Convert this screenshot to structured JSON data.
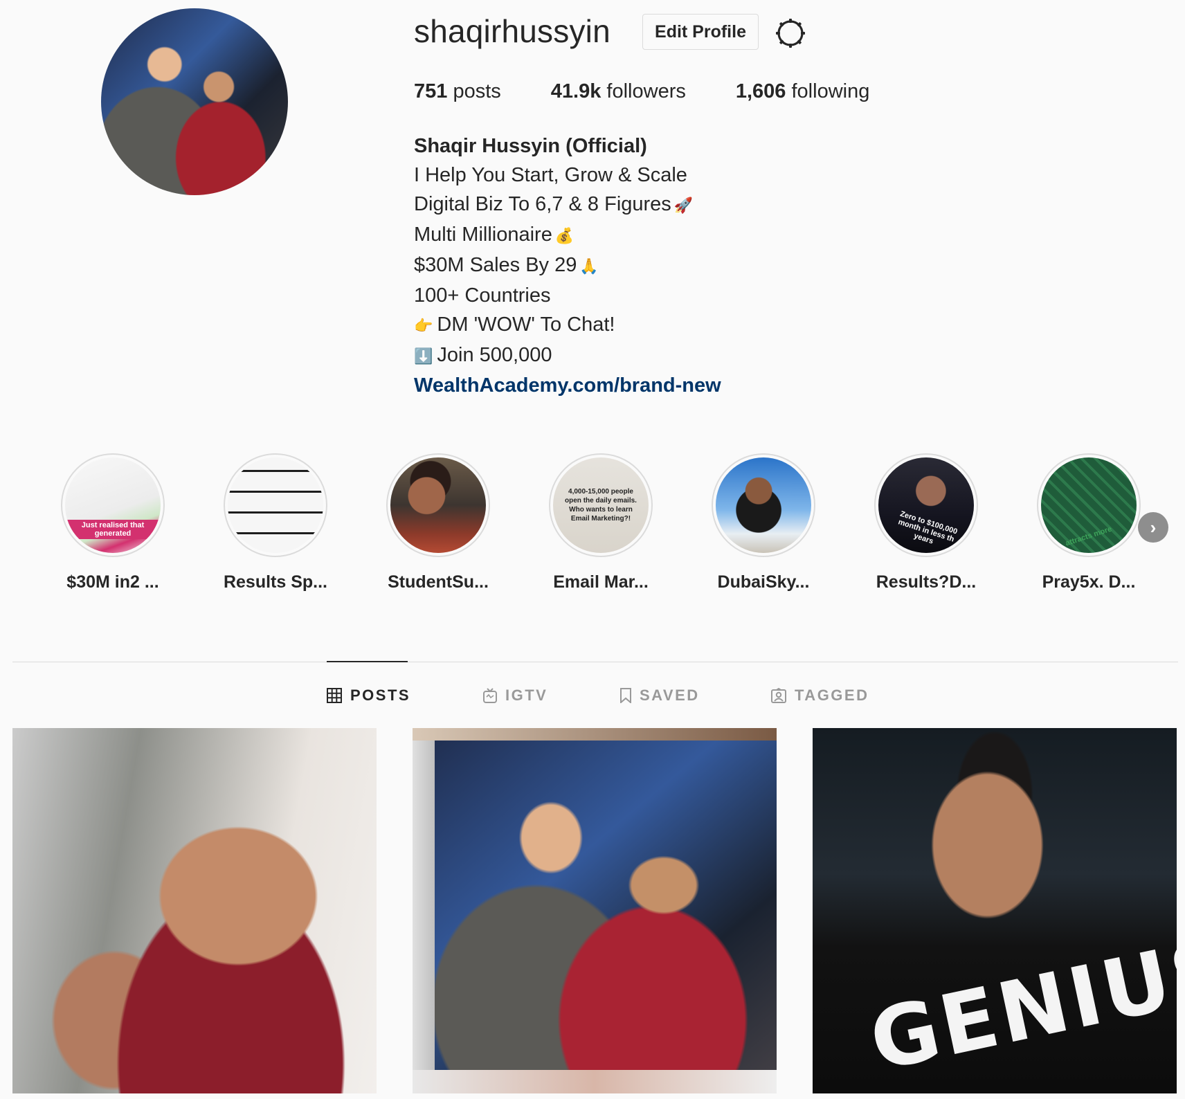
{
  "profile": {
    "username": "shaqirhussyin",
    "edit_button": "Edit Profile",
    "stats": {
      "posts_count": "751",
      "posts_label": "posts",
      "followers_count": "41.9k",
      "followers_label": "followers",
      "following_count": "1,606",
      "following_label": "following"
    },
    "bio": {
      "name": "Shaqir Hussyin (Official)",
      "line1": "I Help You Start, Grow & Scale",
      "line2": "Digital Biz To 6,7 & 8 Figures",
      "line2_emoji": "🚀",
      "line3": "Multi Millionaire",
      "line3_emoji": "💰",
      "line4": "$30M Sales By 29",
      "line4_emoji": "🙏",
      "line5": "100+ Countries",
      "line6_emoji": "👉",
      "line6": "DM 'WOW' To Chat!",
      "line7_emoji": "⬇️",
      "line7": "Join 500,000",
      "link": "WealthAcademy.com/brand-new"
    }
  },
  "highlights": [
    {
      "label": "$30M in2 ...",
      "text": "Just realised that generated"
    },
    {
      "label": "Results Sp...",
      "text": ""
    },
    {
      "label": "StudentSu...",
      "text": ""
    },
    {
      "label": "Email Mar...",
      "text": "4,000-15,000 people open the daily emails. Who wants to learn Email Marketing?!"
    },
    {
      "label": "DubaiSky...",
      "text": ""
    },
    {
      "label": "Results?D...",
      "text": "Zero to $100,000 month in less th years"
    },
    {
      "label": "Pray5x. D...",
      "text": "attracts more"
    }
  ],
  "tabs": [
    {
      "label": "POSTS",
      "icon": "grid-icon",
      "active": true
    },
    {
      "label": "IGTV",
      "icon": "tv-icon",
      "active": false
    },
    {
      "label": "SAVED",
      "icon": "bookmark-icon",
      "active": false
    },
    {
      "label": "TAGGED",
      "icon": "tagged-user-icon",
      "active": false
    }
  ],
  "posts": [
    {
      "alt": "smiling man selfie"
    },
    {
      "alt": "two men at event"
    },
    {
      "alt": "man in glasses"
    }
  ],
  "post3_shirt_text": "GENIUS",
  "colors": {
    "background": "#fafafa",
    "text": "#262626",
    "link": "#003569",
    "border": "#dbdbdb",
    "muted": "#999999"
  }
}
